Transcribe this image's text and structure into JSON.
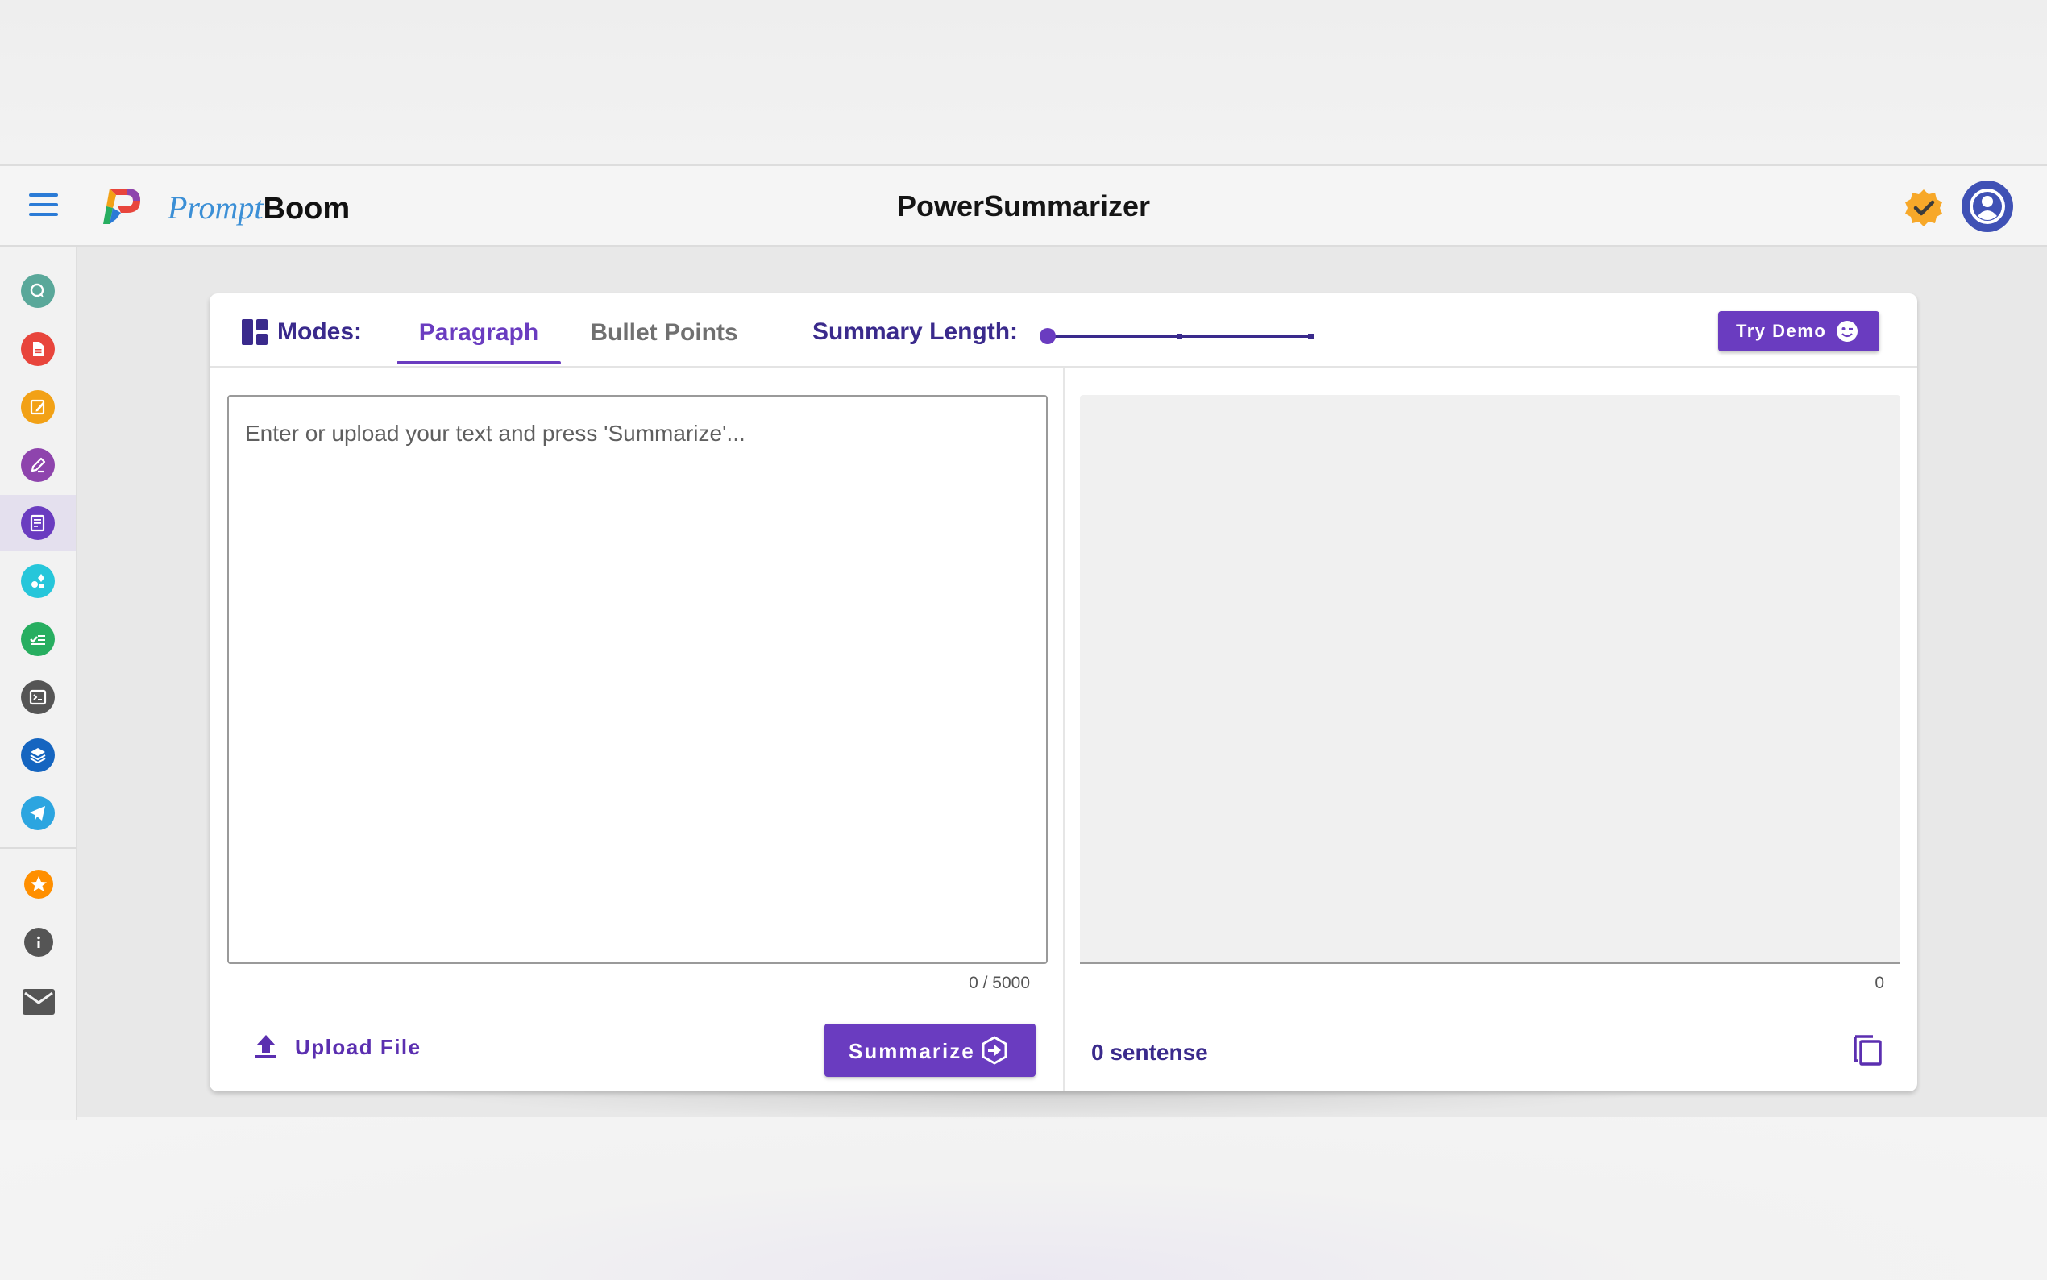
{
  "app": {
    "brand_prefix": "Prompt",
    "brand_suffix": "Boom",
    "title": "PowerSummarizer",
    "accent_color": "#6a3cc0"
  },
  "header": {
    "menu_icon": "hamburger-menu-icon",
    "verified_icon": "verified-badge-icon",
    "account_icon": "account-circle-icon"
  },
  "sidebar": {
    "items": [
      {
        "icon": "chat-icon",
        "color": "#5aa89a"
      },
      {
        "icon": "document-icon",
        "color": "#e8453c"
      },
      {
        "icon": "edit-note-icon",
        "color": "#f2a116"
      },
      {
        "icon": "pen-icon",
        "color": "#8e44ad"
      },
      {
        "icon": "summarize-icon",
        "color": "#6a3cc0",
        "active": true
      },
      {
        "icon": "shapes-icon",
        "color": "#26c6da"
      },
      {
        "icon": "checklist-icon",
        "color": "#27ae60"
      },
      {
        "icon": "terminal-icon",
        "color": "#555555"
      },
      {
        "icon": "layers-icon",
        "color": "#1565c0"
      },
      {
        "icon": "telegram-icon",
        "color": "#2ca5e0"
      }
    ],
    "bottom_items": [
      {
        "icon": "star-icon",
        "color": "#ff8f00"
      },
      {
        "icon": "info-icon",
        "color": "#555555"
      },
      {
        "icon": "mail-icon",
        "color": "#555555"
      }
    ]
  },
  "modes": {
    "label": "Modes:",
    "tabs": [
      {
        "label": "Paragraph",
        "active": true
      },
      {
        "label": "Bullet Points",
        "active": false
      }
    ]
  },
  "summary_length": {
    "label": "Summary Length:",
    "value": 0,
    "steps": 3
  },
  "try_demo": {
    "label": "Try Demo"
  },
  "input": {
    "placeholder": "Enter or upload your text and press 'Summarize'...",
    "value": "",
    "counter": "0 / 5000"
  },
  "upload": {
    "label": "Upload File"
  },
  "summarize": {
    "label": "Summarize"
  },
  "output": {
    "counter": "0",
    "sentence_count": "0 sentense"
  }
}
